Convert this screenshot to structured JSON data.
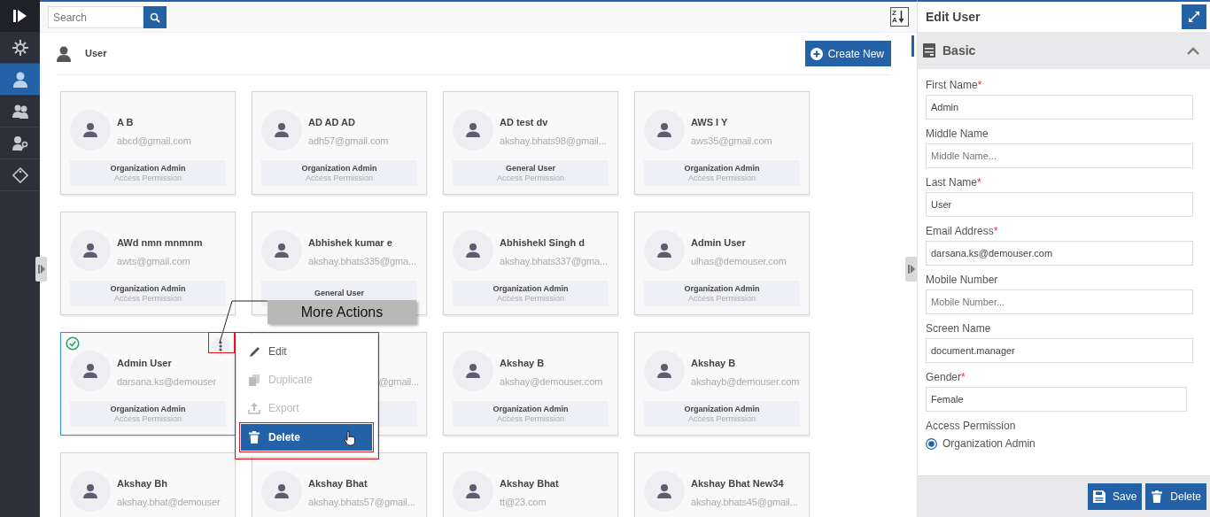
{
  "sidebar": {
    "items": [
      {
        "kind": "gear",
        "selected": false
      },
      {
        "kind": "user",
        "selected": true
      },
      {
        "kind": "users",
        "selected": false
      },
      {
        "kind": "userkey",
        "selected": false
      },
      {
        "kind": "tag",
        "selected": false
      }
    ]
  },
  "toolbar": {
    "search": {
      "placeholder": "Search"
    },
    "sort": {
      "upper": "Z",
      "lower": "A"
    }
  },
  "header": {
    "title": "User",
    "create_button": "Create New"
  },
  "cards": [
    {
      "name": "A B",
      "email": "abcd@gmail.com",
      "role": "Organization Admin",
      "permission_label": "Access Permission",
      "selected": false
    },
    {
      "name": "AD AD AD",
      "email": "adh57@gmail.com",
      "role": "Organization Admin",
      "permission_label": "Access Permission",
      "selected": false
    },
    {
      "name": "AD test dv",
      "email": "akshay.bhats98@gmail...",
      "role": "General User",
      "permission_label": "Access Permission",
      "selected": false
    },
    {
      "name": "AWS I Y",
      "email": "aws35@gmail.com",
      "role": "Organization Admin",
      "permission_label": "Access Permission",
      "selected": false
    },
    {
      "name": "AWd nmn mnmnm",
      "email": "awts@gmail.com",
      "role": "Organization Admin",
      "permission_label": "Access Permission",
      "selected": false
    },
    {
      "name": "Abhishek kumar e",
      "email": "akshay.bhats335@gma...",
      "role": "General User",
      "selected": false
    },
    {
      "name": "Abhishekl Singh d",
      "email": "akshay.bhats337@gma...",
      "role": "Organization Admin",
      "permission_label": "Access Permission",
      "selected": false
    },
    {
      "name": "Admin User",
      "email": "ulhas@demouser.com",
      "role": "Organization Admin",
      "permission_label": "Access Permission",
      "selected": false
    },
    {
      "name": "Admin User",
      "email": "darsana.ks@demouser",
      "role": "Organization Admin",
      "permission_label": "Access Permission",
      "selected": true
    },
    {
      "email": "@gmail...",
      "selected": false
    },
    {
      "name": "Akshay B",
      "email": "akshay@demouser.com",
      "role": "Organization Admin",
      "permission_label": "Access Permission",
      "selected": false
    },
    {
      "name": "Akshay B",
      "email": "akshayb@demouser.com",
      "role": "Organization Admin",
      "permission_label": "Access Permission",
      "selected": false
    },
    {
      "name": "Akshay Bh",
      "email": "akshay.bhat@demouser",
      "selected": false
    },
    {
      "name": "Akshay Bhat",
      "email": "akshay.bhats57@gmail...",
      "selected": false
    },
    {
      "name": "Akshay Bhat",
      "email": "tt@23.com",
      "selected": false
    },
    {
      "name": "Akshay Bhat New34",
      "email": "akshay.bhats45@gmail...",
      "selected": false
    }
  ],
  "context_menu": {
    "items": [
      {
        "label": "Edit",
        "kind": "edit",
        "disabled": false,
        "selected": false
      },
      {
        "label": "Duplicate",
        "kind": "duplicate",
        "disabled": true,
        "selected": false
      },
      {
        "label": "Export",
        "kind": "export",
        "disabled": true,
        "selected": false
      },
      {
        "label": "Delete",
        "kind": "delete",
        "disabled": false,
        "selected": true
      }
    ]
  },
  "callout": "More Actions",
  "edit_panel": {
    "title": "Edit User",
    "required_mark": "*",
    "section": {
      "title": "Basic",
      "expanded": true
    },
    "fields": [
      {
        "label": "First Name",
        "required": true,
        "value": "Admin"
      },
      {
        "label": "Middle Name",
        "required": false,
        "placeholder": "Middle Name..."
      },
      {
        "label": "Last Name",
        "required": true,
        "value": "User"
      },
      {
        "label": "Email Address",
        "required": true,
        "value": "darsana.ks@demouser.com"
      },
      {
        "label": "Mobile Number",
        "required": false,
        "placeholder": "Mobile Number..."
      },
      {
        "label": "Screen Name",
        "required": false,
        "value": "document.manager"
      },
      {
        "label": "Gender",
        "required": true,
        "value": "Female"
      }
    ],
    "access_permission": {
      "label": "Access Permission",
      "options": [
        {
          "label": "Organization Admin",
          "selected": true
        }
      ]
    },
    "buttons": [
      {
        "label": "Save",
        "kind": "save"
      },
      {
        "label": "Delete",
        "kind": "delete"
      }
    ]
  }
}
